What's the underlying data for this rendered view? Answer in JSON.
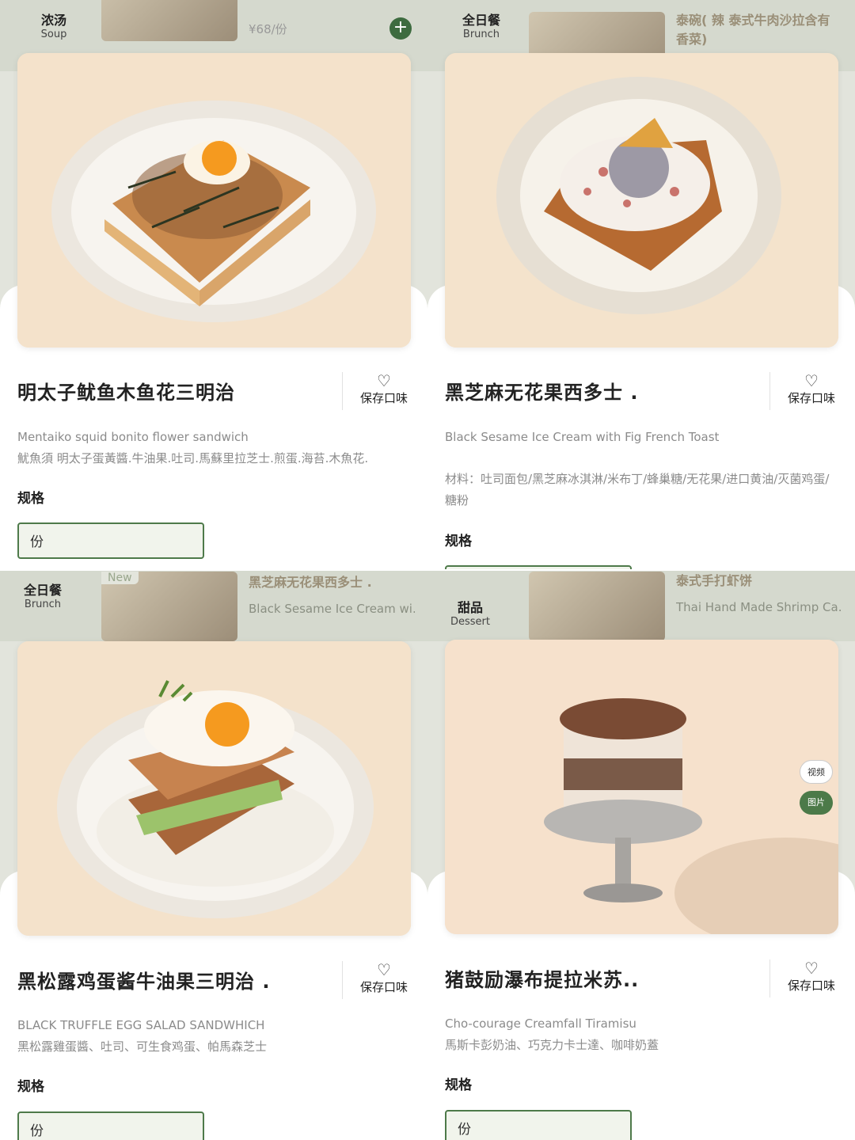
{
  "panels": {
    "tl": {
      "bg_category": {
        "zh": "浓汤",
        "en": "Soup"
      },
      "bg_price": "¥68/份",
      "title": "明太子鱿鱼木鱼花三明治",
      "fav_label": "保存口味",
      "desc_en": "Mentaiko squid bonito flower sandwich",
      "desc_zh": "魷魚須 明太子蛋黃醬.牛油果.吐司.馬蘇里拉芝士.煎蛋.海苔.木魚花.",
      "spec_label": "规格",
      "spec_value": "份"
    },
    "tr": {
      "bg_category": {
        "zh": "全日餐",
        "en": "Brunch"
      },
      "bg_title": "泰碗( 辣 泰式牛肉沙拉含有香菜)",
      "title": "黑芝麻无花果西多士 .",
      "fav_label": "保存口味",
      "desc_en": "Black Sesame Ice Cream with Fig French Toast",
      "desc_zh": "材料：吐司面包/黑芝麻冰淇淋/米布丁/蜂巢糖/无花果/进口黄油/灭菌鸡蛋/糖粉",
      "spec_label": "规格"
    },
    "bl": {
      "bg_category": {
        "zh": "全日餐",
        "en": "Brunch"
      },
      "bg_new": "New",
      "bg_title": "黑芝麻无花果西多士 .",
      "bg_sub": "Black Sesame Ice Cream wi…",
      "title": "黑松露鸡蛋酱牛油果三明治 .",
      "fav_label": "保存口味",
      "desc_en": "BLACK TRUFFLE EGG SALAD SANDWHICH",
      "desc_zh": "黑松露雞蛋醬、吐司、可生食鸡蛋、帕馬森芝士",
      "spec_label": "规格",
      "spec_value": "份"
    },
    "br": {
      "bg_category": {
        "zh": "甜品",
        "en": "Dessert"
      },
      "bg_title": "泰式手打虾饼",
      "bg_sub": "Thai Hand Made Shrimp Ca…",
      "title": "猪鼓励瀑布提拉米苏..",
      "fav_label": "保存口味",
      "desc_en": "Cho-courage Creamfall Tiramisu",
      "desc_zh": "馬斯卡彭奶油、巧克力卡士達、咖啡奶蓋",
      "spec_label": "规格",
      "spec_value": "份",
      "side_video": "视频",
      "side_pic": "图片"
    }
  },
  "icons": {
    "heart": "heart-outline-icon",
    "plus": "plus-icon"
  },
  "colors": {
    "accent": "#4e7a4a",
    "bg": "#e2e4dc"
  }
}
